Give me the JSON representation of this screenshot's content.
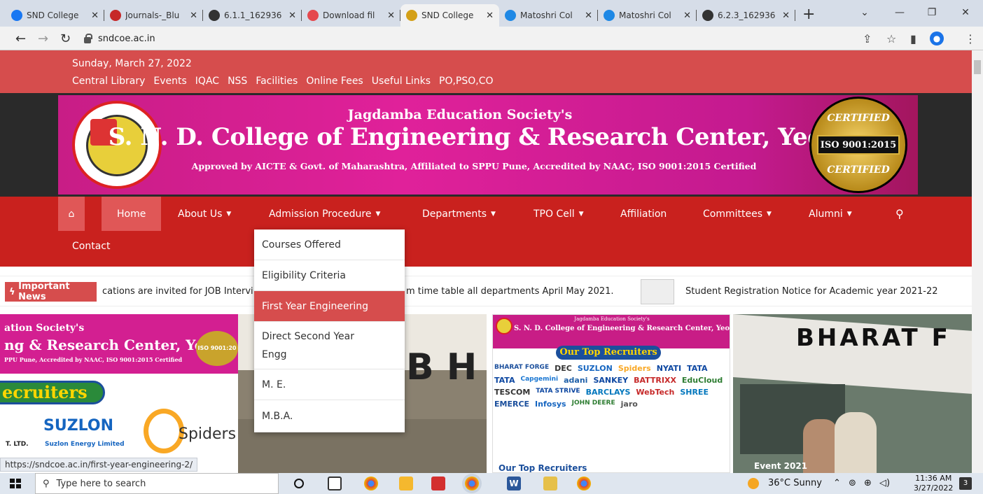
{
  "browser": {
    "tabs": [
      {
        "title": "SND College",
        "icon": "facebook-icon",
        "color": "#1877f2"
      },
      {
        "title": "Journals-_Blu",
        "icon": "journal-icon",
        "color": "#c62828"
      },
      {
        "title": "6.1.1_162936",
        "icon": "globe-icon",
        "color": "#333333"
      },
      {
        "title": "Download fil",
        "icon": "heart-icon",
        "color": "#e5484d"
      },
      {
        "title": "SND College",
        "icon": "college-logo-icon",
        "color": "#d4a017"
      },
      {
        "title": "Matoshri Col",
        "icon": "college-logo-icon",
        "color": "#1e88e5"
      },
      {
        "title": "Matoshri Col",
        "icon": "college-logo-icon",
        "color": "#1e88e5"
      },
      {
        "title": "6.2.3_162936",
        "icon": "globe-icon",
        "color": "#333333"
      }
    ],
    "active_tab": 4,
    "url": "sndcoe.ac.in"
  },
  "site": {
    "date": "Sunday, March 27, 2022",
    "top_links": [
      "Central Library",
      "Events",
      "IQAC",
      "NSS",
      "Facilities",
      "Online Fees",
      "Useful Links",
      "PO,PSO,CO"
    ],
    "banner": {
      "society": "Jagdamba Education Society's",
      "title": "S. N. D. College of Engineering & Research Center, Yeola",
      "approved": "Approved by AICTE & Govt. of Maharashtra, Affiliated to SPPU Pune, Accredited by NAAC, ISO 9001:2015 Certified",
      "cert_top": "CERTIFIED",
      "cert_mid": "ISO 9001:2015",
      "cert_bottom": "CERTIFIED"
    },
    "nav": [
      {
        "label": "Home",
        "dropdown": false
      },
      {
        "label": "About Us",
        "dropdown": true
      },
      {
        "label": "Admission Procedure",
        "dropdown": true
      },
      {
        "label": "Departments",
        "dropdown": true
      },
      {
        "label": "TPO Cell",
        "dropdown": true
      },
      {
        "label": "Affiliation",
        "dropdown": false
      },
      {
        "label": "Committees",
        "dropdown": true
      },
      {
        "label": "Alumni",
        "dropdown": true
      },
      {
        "label": "Contact",
        "dropdown": false
      }
    ],
    "dropdown": [
      "Courses Offered",
      "Eligibility Criteria",
      "First Year Engineering",
      "Direct Second Year Engg",
      "M. E.",
      "M.B.A."
    ],
    "dropdown_active": 2,
    "news_label": "Important News",
    "news": [
      "cations are invited for JOB Intervi",
      "m time table all departments April May 2021.",
      "Student Registration Notice for Academic year 2021-22"
    ],
    "slides": {
      "s1_society": "ation Society's",
      "s1_title": "ng & Research Center, Yeola",
      "s1_sub": "PPU Pune, Accredited by NAAC, ISO 9001:2015 Certified",
      "s1_recruiters": "ecruiters",
      "s1_suzlon": "SUZLON",
      "s1_suzlon_sub": "Suzlon Energy Limited",
      "s1_spiders": "Spiders",
      "s1_ltd": "T. LTD.",
      "s1_iso": "ISO 9001:20",
      "s2_text": "B H",
      "s3_society": "Jagdamba Education Society's",
      "s3_title": "S. N. D. College of Engineering & Research Center, Yeola",
      "s3_recruiters": "Our Top Recruiters",
      "s3_logos": [
        "BHARAT FORGE",
        "DEC",
        "SUZLON",
        "Spiders",
        "NYATI",
        "TATA",
        "TATA",
        "Capgemini",
        "adani",
        "SANKEY",
        "BATTRIXX",
        "EduCloud",
        "TESCOM",
        "TATA STRIVE",
        "BARCLAYS",
        "WebTech",
        "SHREE",
        "EMERCE",
        "Infosys",
        "JOHN DEERE",
        "jaro"
      ],
      "s3_footer": "Our Top Recruiters",
      "s4_text": "BHARAT F",
      "s4_event": "Event 2021"
    }
  },
  "status_url": "https://sndcoe.ac.in/first-year-engineering-2/",
  "taskbar": {
    "search_placeholder": "Type here to search",
    "weather": "36°C Sunny",
    "time": "11:36 AM",
    "date": "3/27/2022",
    "notifications": "3"
  }
}
